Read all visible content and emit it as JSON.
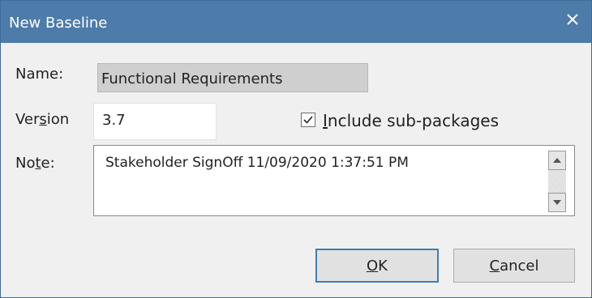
{
  "dialog": {
    "title": "New Baseline",
    "colors": {
      "titlebar": "#4d7baa",
      "accent_border": "#3c7fb1"
    }
  },
  "fields": {
    "name": {
      "label_pre": "",
      "label_key": "",
      "label_post": "Name:",
      "value": "Functional Requirements"
    },
    "version": {
      "label_pre": "Ver",
      "label_key": "s",
      "label_post": "ion",
      "value": "3.7"
    },
    "include_subpackages": {
      "checked": true,
      "label_key": "I",
      "label_post": "nclude sub-packages"
    },
    "note": {
      "label_pre": "No",
      "label_key": "t",
      "label_post": "e:",
      "value": "Stakeholder SignOff 11/09/2020 1:37:51 PM"
    }
  },
  "buttons": {
    "ok": {
      "key": "O",
      "rest": "K"
    },
    "cancel": {
      "key": "C",
      "rest": "ancel"
    }
  },
  "icons": {
    "close": "close-icon",
    "check": "check-icon",
    "scroll_up": "scroll-up-icon",
    "scroll_down": "scroll-down-icon"
  }
}
